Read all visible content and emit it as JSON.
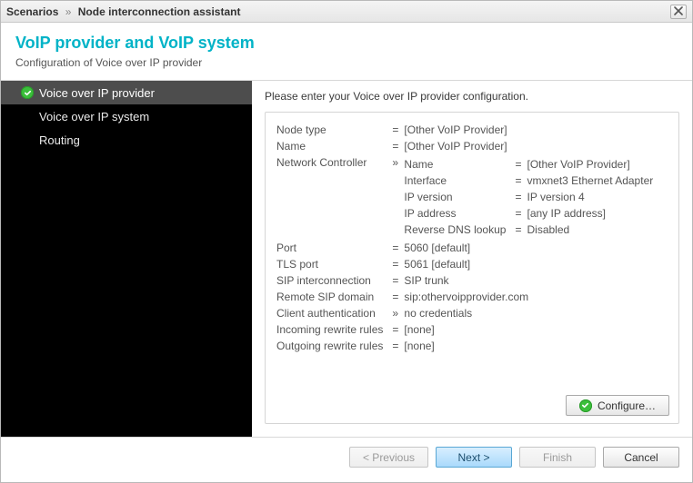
{
  "titlebar": {
    "root": "Scenarios",
    "sep": "»",
    "current": "Node interconnection assistant"
  },
  "header": {
    "title": "VoIP provider and VoIP system",
    "subtitle": "Configuration of Voice over IP provider"
  },
  "sidebar": {
    "items": [
      {
        "label": "Voice over IP provider",
        "active": true,
        "checked": true
      },
      {
        "label": "Voice over IP system",
        "active": false,
        "checked": false
      },
      {
        "label": "Routing",
        "active": false,
        "checked": false
      }
    ]
  },
  "main": {
    "prompt": "Please enter your Voice over IP provider configuration.",
    "props": {
      "node_type": {
        "key": "Node type",
        "val": "[Other VoIP Provider]"
      },
      "name": {
        "key": "Name",
        "val": "[Other VoIP Provider]"
      },
      "netctrl": {
        "key": "Network Controller"
      },
      "nc": {
        "name": {
          "key": "Name",
          "val": "[Other VoIP Provider]"
        },
        "interface": {
          "key": "Interface",
          "val": "vmxnet3 Ethernet Adapter"
        },
        "ipver": {
          "key": "IP version",
          "val": "IP version 4"
        },
        "ipaddr": {
          "key": "IP address",
          "val": "[any IP address]"
        },
        "rdns": {
          "key": "Reverse DNS lookup",
          "val": "Disabled"
        }
      },
      "port": {
        "key": "Port",
        "val": "5060 [default]"
      },
      "tls": {
        "key": "TLS port",
        "val": "5061 [default]"
      },
      "sipi": {
        "key": "SIP interconnection",
        "val": "SIP trunk"
      },
      "rsip": {
        "key": "Remote SIP domain",
        "val": "sip:othervoipprovider.com"
      },
      "cauth": {
        "key": "Client authentication",
        "exp": "»",
        "val": "no credentials"
      },
      "inr": {
        "key": "Incoming rewrite rules",
        "val": "[none]"
      },
      "outr": {
        "key": "Outgoing rewrite rules",
        "val": "[none]"
      }
    },
    "configure": "Configure…"
  },
  "footer": {
    "previous": "< Previous",
    "next": "Next >",
    "finish": "Finish",
    "cancel": "Cancel"
  },
  "sym": {
    "eq": "=",
    "exp": "»"
  }
}
